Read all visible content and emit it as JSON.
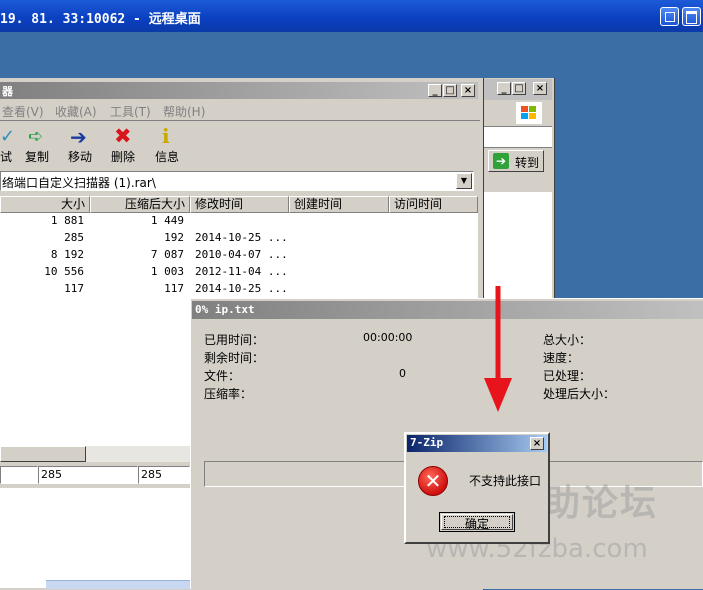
{
  "rdp": {
    "title": "19. 81. 33:10062 - 远程桌面"
  },
  "fm": {
    "title": "器",
    "menu": [
      "查看(V)",
      "收藏(A)",
      "工具(T)",
      "帮助(H)"
    ],
    "toolbar": [
      "试",
      "复制",
      "移动",
      "删除",
      "信息"
    ],
    "address": "络端口自定义扫描器 (1).rar\\",
    "columns": [
      "大小",
      "压缩后大小",
      "修改时间",
      "创建时间",
      "访问时间"
    ],
    "rows": [
      {
        "size": "1 881",
        "packed": "1 449",
        "modified": ""
      },
      {
        "size": "285",
        "packed": "192",
        "modified": "2014-10-25 ..."
      },
      {
        "size": "8 192",
        "packed": "7 087",
        "modified": "2010-04-07 ..."
      },
      {
        "size": "10 556",
        "packed": "1 003",
        "modified": "2012-11-04 ..."
      },
      {
        "size": "117",
        "packed": "117",
        "modified": "2014-10-25 ..."
      }
    ],
    "status": [
      "285",
      "285"
    ]
  },
  "bg_win": {
    "goto": "转到"
  },
  "progress": {
    "title": "0% ip.txt",
    "elapsed_label": "已用时间：",
    "elapsed_value": "00:00:00",
    "remaining_label": "剩余时间：",
    "files_label": "文件：",
    "files_value": "0",
    "ratio_label": "压缩率：",
    "total_label": "总大小：",
    "speed_label": "速度：",
    "processed_label": "已处理：",
    "processed_size_label": "处理后大小："
  },
  "dialog": {
    "title": "7-Zip",
    "message": "不支持此接口",
    "ok": "确定"
  },
  "watermark": {
    "line1": "我爱辅助论坛",
    "line2": "www.52fzba.com"
  },
  "colors": {
    "arrow": "#e8141c",
    "rdp_blue": "#0a3fbf",
    "desktop": "#3a6ea5"
  }
}
